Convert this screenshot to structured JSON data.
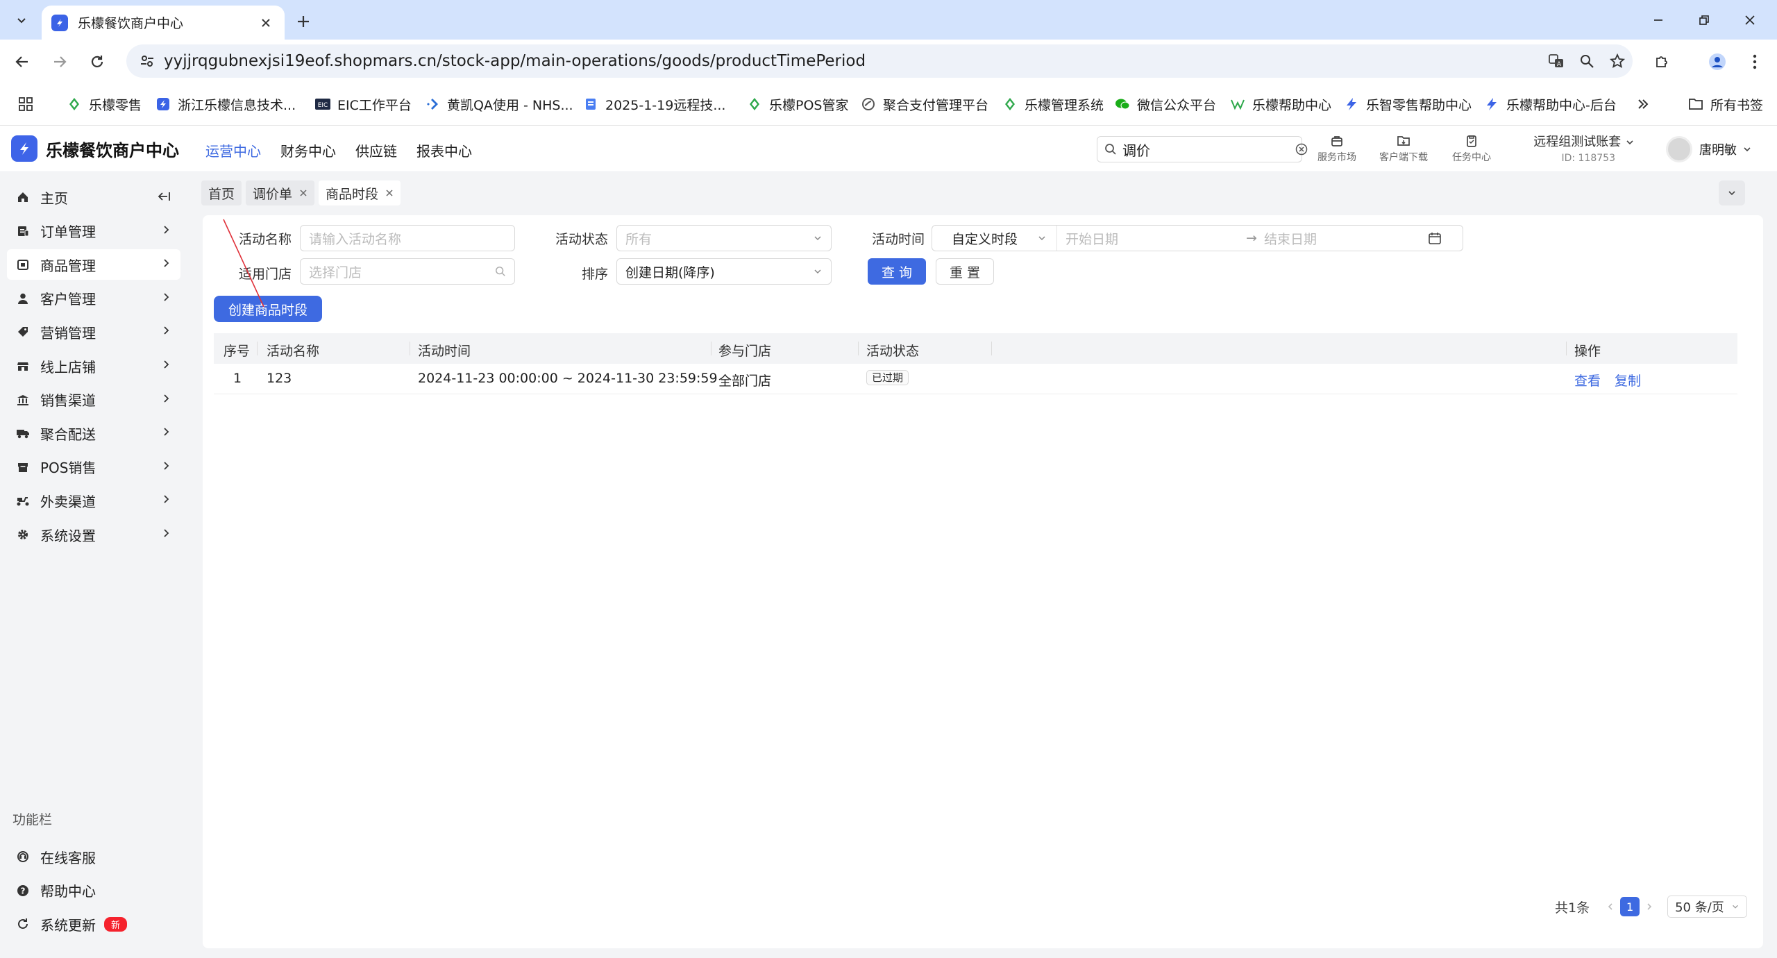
{
  "browser": {
    "tab_title": "乐檬餐饮商户中心",
    "url": "yyjjrqgubnexjsi19eof.shopmars.cn/stock-app/main-operations/goods/productTimePeriod"
  },
  "bookmarks": [
    {
      "label": "乐檬零售",
      "icon": "lemon-icon",
      "color": "#2ea84b"
    },
    {
      "label": "浙江乐檬信息技术...",
      "icon": "lemon-blue-icon",
      "color": "#3b63e6"
    },
    {
      "label": "EIC工作平台",
      "icon": "eic-icon",
      "color": "#1f2a44"
    },
    {
      "label": "黄凯QA使用 - NHS...",
      "icon": "jira-icon",
      "color": "#2c6fd6"
    },
    {
      "label": "2025-1-19远程技...",
      "icon": "doc-icon",
      "color": "#4a7ef2"
    },
    {
      "label": "乐檬POS管家",
      "icon": "lemon-icon",
      "color": "#2ea84b"
    },
    {
      "label": "聚合支付管理平台",
      "icon": "globe-icon",
      "color": "#555555"
    },
    {
      "label": "乐檬管理系统",
      "icon": "lemon-icon",
      "color": "#2ea84b"
    },
    {
      "label": "微信公众平台",
      "icon": "wechat-icon",
      "color": "#1aad19"
    },
    {
      "label": "乐檬帮助中心",
      "icon": "help-logo-icon",
      "color": "#2ea84b"
    },
    {
      "label": "乐智零售帮助中心",
      "icon": "lezhi-icon",
      "color": "#3b63e6"
    },
    {
      "label": "乐檬帮助中心-后台",
      "icon": "lezhi-icon",
      "color": "#3b63e6"
    }
  ],
  "bookmarks_all": "所有书签",
  "app": {
    "logo_text": "乐檬餐饮商户中心",
    "topnav": [
      "运营中心",
      "财务中心",
      "供应链",
      "报表中心"
    ],
    "search_value": "调价",
    "tools": [
      "服务市场",
      "客户端下载",
      "任务中心"
    ],
    "account_name": "远程组测试账套",
    "account_id": "ID: 118753",
    "user_name": "唐明敏",
    "accent": "#3e6ae1"
  },
  "sidebar": {
    "items": [
      {
        "label": "主页",
        "icon": "home-icon"
      },
      {
        "label": "订单管理",
        "icon": "order-icon"
      },
      {
        "label": "商品管理",
        "icon": "goods-icon"
      },
      {
        "label": "客户管理",
        "icon": "user-icon"
      },
      {
        "label": "营销管理",
        "icon": "tag-icon"
      },
      {
        "label": "线上店铺",
        "icon": "shop-icon"
      },
      {
        "label": "销售渠道",
        "icon": "bank-icon"
      },
      {
        "label": "聚合配送",
        "icon": "delivery-icon"
      },
      {
        "label": "POS销售",
        "icon": "pos-icon"
      },
      {
        "label": "外卖渠道",
        "icon": "scooter-icon"
      },
      {
        "label": "系统设置",
        "icon": "gear-icon"
      }
    ],
    "func_title": "功能栏",
    "func_items": [
      {
        "label": "在线客服",
        "icon": "service-icon"
      },
      {
        "label": "帮助中心",
        "icon": "help-icon"
      },
      {
        "label": "系统更新",
        "icon": "refresh-icon"
      }
    ],
    "new_badge": "新"
  },
  "page_tabs": [
    {
      "label": "首页",
      "closable": false
    },
    {
      "label": "调价单",
      "closable": true
    },
    {
      "label": "商品时段",
      "closable": true
    }
  ],
  "filters": {
    "name_label": "活动名称",
    "name_placeholder": "请输入活动名称",
    "status_label": "活动状态",
    "status_placeholder": "所有",
    "time_label": "活动时间",
    "time_mode": "自定义时段",
    "start_placeholder": "开始日期",
    "end_placeholder": "结束日期",
    "range_arrow": "→",
    "store_label": "适用门店",
    "store_placeholder": "选择门店",
    "sort_label": "排序",
    "sort_value": "创建日期(降序)",
    "query_btn": "查 询",
    "reset_btn": "重 置"
  },
  "create_btn": "创建商品时段",
  "table": {
    "headers": [
      "序号",
      "活动名称",
      "活动时间",
      "参与门店",
      "活动状态",
      "操作"
    ],
    "rows": [
      {
        "index": "1",
        "name": "123",
        "time": "2024-11-23 00:00:00 ~ 2024-11-30 23:59:59",
        "store": "全部门店",
        "status": "已过期",
        "actions": [
          "查看",
          "复制"
        ]
      }
    ]
  },
  "pager": {
    "total": "共1条",
    "current": "1",
    "page_size": "50 条/页"
  }
}
